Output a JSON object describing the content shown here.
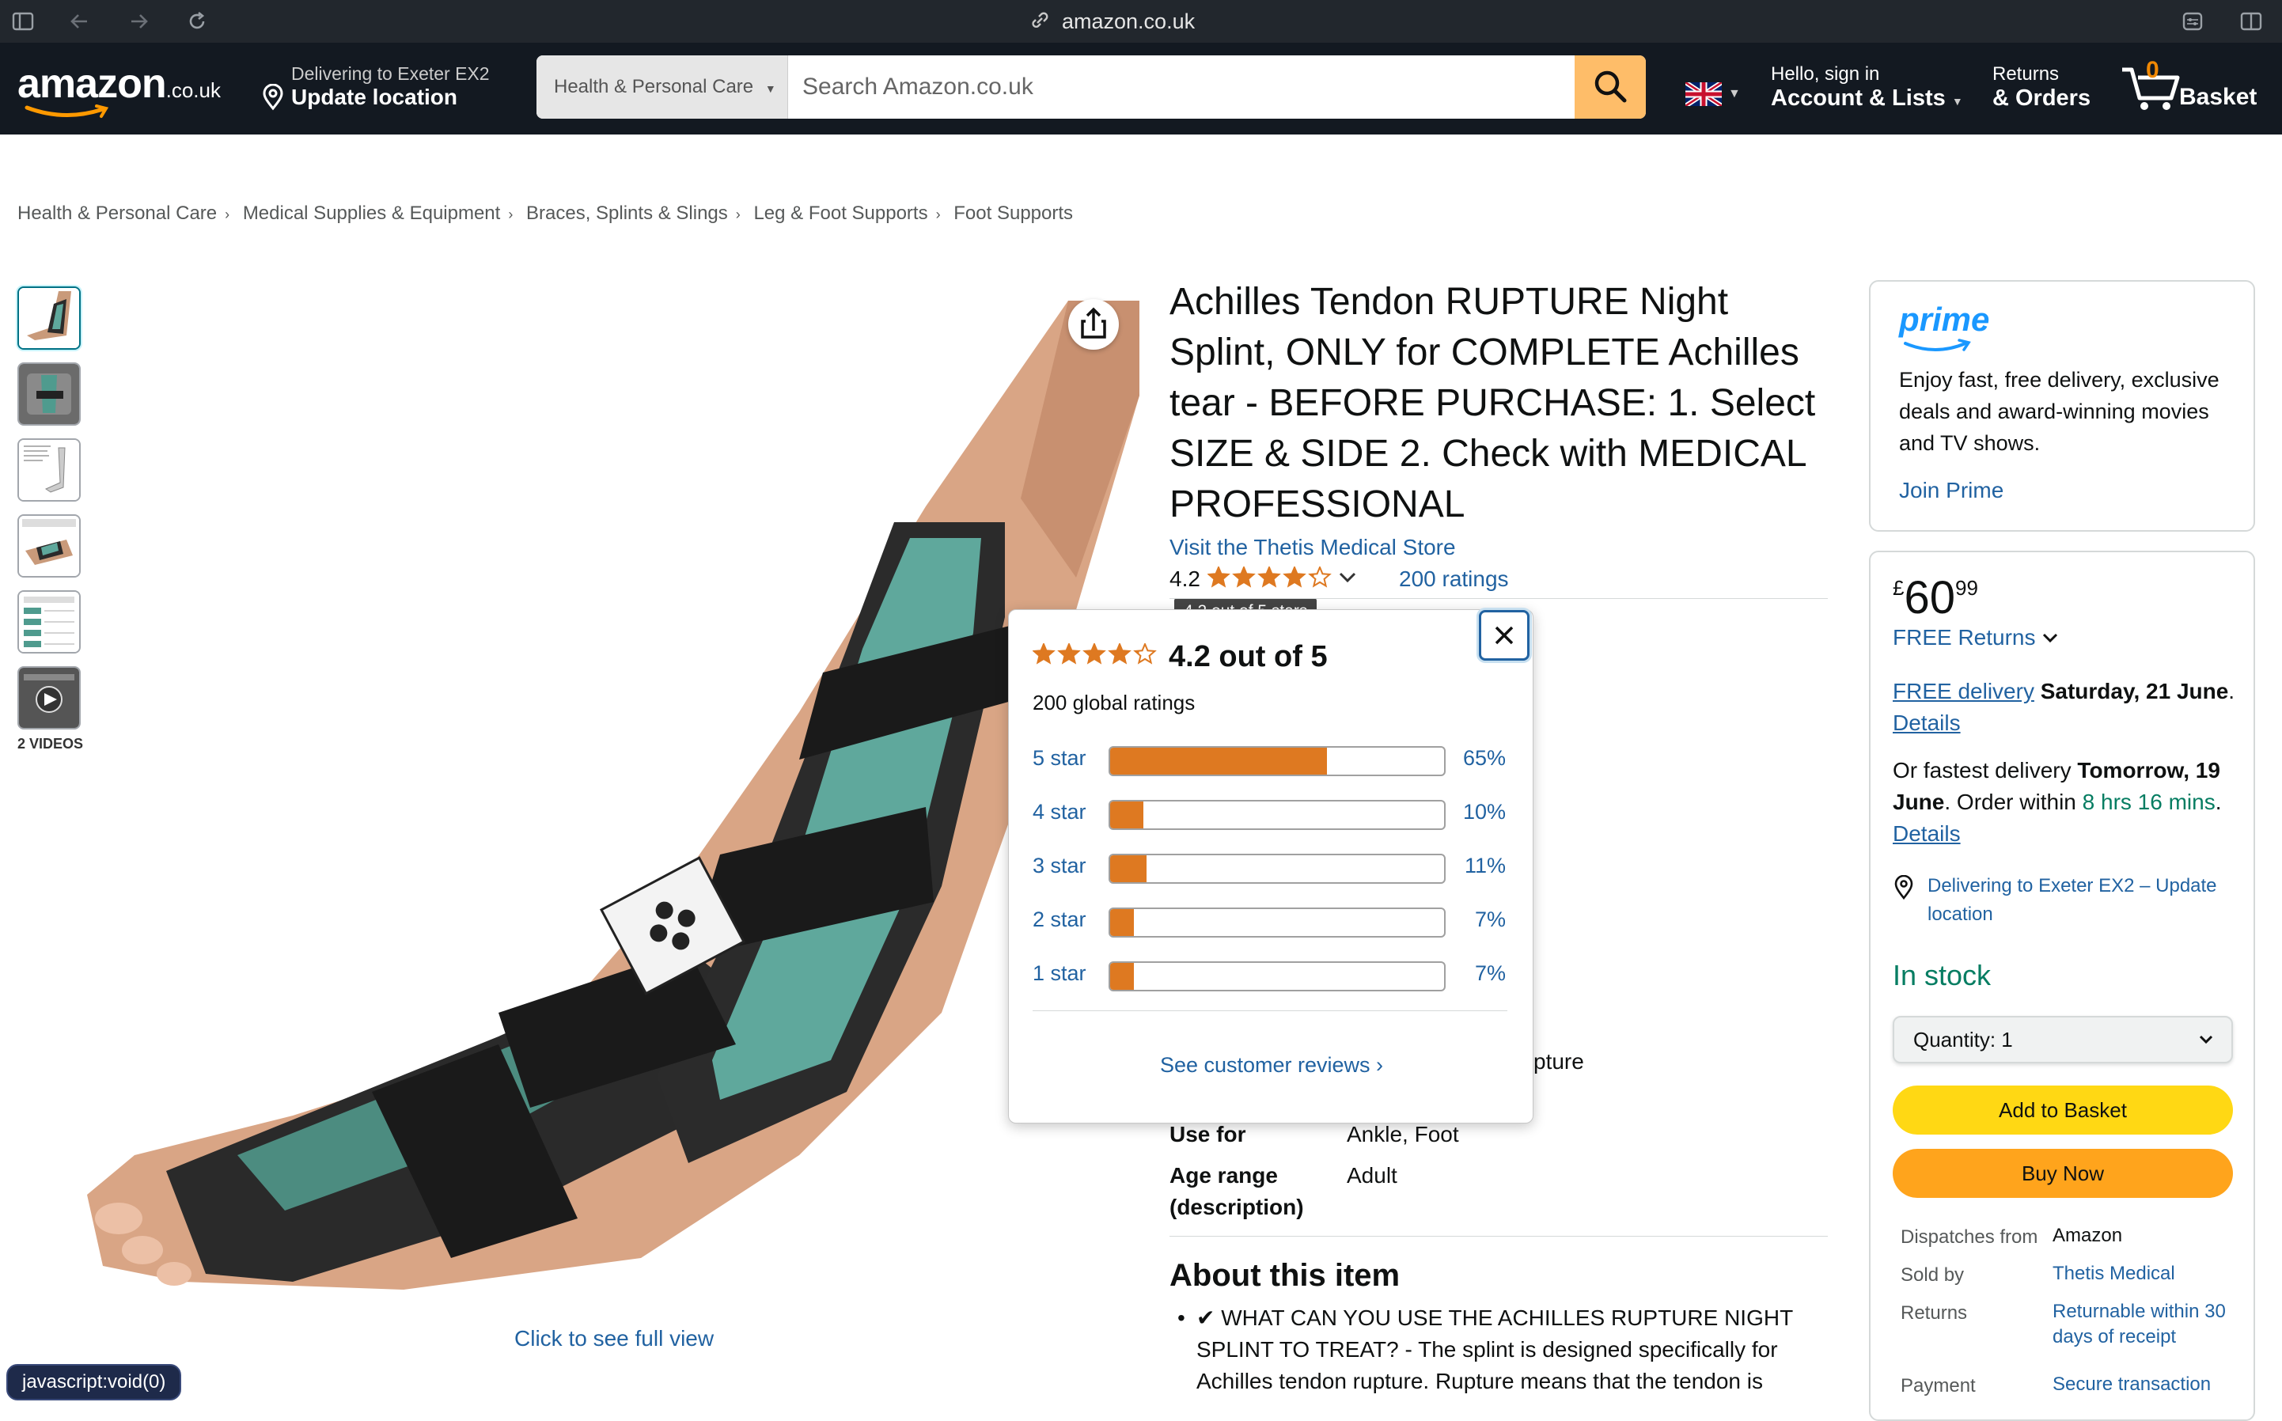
{
  "browser": {
    "url": "amazon.co.uk"
  },
  "header": {
    "logo_text": "amazon",
    "logo_tld": ".co.uk",
    "deliver_line1": "Delivering to Exeter EX2",
    "deliver_line2": "Update location",
    "search_category": "Health & Personal Care",
    "search_placeholder": "Search Amazon.co.uk",
    "account_line1": "Hello, sign in",
    "account_line2": "Account & Lists",
    "returns_line1": "Returns",
    "returns_line2": "& Orders",
    "basket_count": "0",
    "basket_label": "Basket"
  },
  "breadcrumb": [
    "Health & Personal Care",
    "Medical Supplies & Equipment",
    "Braces, Splints & Slings",
    "Leg & Foot Supports",
    "Foot Supports"
  ],
  "gallery": {
    "videos_label": "2 VIDEOS",
    "full_view": "Click to see full view"
  },
  "product": {
    "title": "Achilles Tendon RUPTURE Night Splint, ONLY for COMPLETE Achilles tear - BEFORE PURCHASE: 1. Select SIZE & SIDE 2. Check with MEDICAL PROFESSIONAL",
    "store_link": "Visit the Thetis Medical Store",
    "rating": "4.2",
    "rating_stars": 4.2,
    "ratings_count": "200 ratings",
    "tooltip": "4.2 out of 5 stars",
    "spec_partial": "pture",
    "specs": [
      {
        "key": "Use for",
        "value": "Ankle, Foot"
      },
      {
        "key": "Age range",
        "key2": "(description)",
        "value": "Adult"
      }
    ],
    "about_title": "About this item",
    "about_bullet": "✔ WHAT CAN YOU USE THE ACHILLES RUPTURE NIGHT SPLINT TO TREAT? - The splint is designed specifically for Achilles tendon rupture. Rupture means that the tendon is"
  },
  "popover": {
    "out_of": "4.2 out of 5",
    "global": "200 global ratings",
    "histogram": [
      {
        "label": "5 star",
        "pct": "65%",
        "value": 65
      },
      {
        "label": "4 star",
        "pct": "10%",
        "value": 10
      },
      {
        "label": "3 star",
        "pct": "11%",
        "value": 11
      },
      {
        "label": "2 star",
        "pct": "7%",
        "value": 7
      },
      {
        "label": "1 star",
        "pct": "7%",
        "value": 7
      }
    ],
    "see_reviews": "See customer reviews ›"
  },
  "prime": {
    "logo": "prime",
    "text": "Enjoy fast, free delivery, exclusive deals and award-winning movies and TV shows.",
    "join": "Join Prime"
  },
  "buybox": {
    "price_currency": "£",
    "price_whole": "60",
    "price_fraction": "99",
    "free_returns": "FREE Returns",
    "free_delivery_link": "FREE delivery",
    "free_delivery_date": "Saturday, 21 June",
    "details": "Details",
    "fastest_prefix": "Or fastest delivery",
    "fastest_date": "Tomorrow, 19 June",
    "order_within": "Order within",
    "order_time": "8 hrs 16 mins",
    "deliver_loc": "Delivering to Exeter EX2 – Update location",
    "in_stock": "In stock",
    "quantity_label": "Quantity:",
    "quantity_value": "1",
    "add_to_basket": "Add to Basket",
    "buy_now": "Buy Now",
    "dispatches_k": "Dispatches from",
    "dispatches_v": "Amazon",
    "sold_k": "Sold by",
    "sold_v": "Thetis Medical",
    "returns_k": "Returns",
    "returns_v": "Returnable within 30 days of receipt",
    "payment_k": "Payment",
    "payment_v": "Secure transaction"
  },
  "status_bar": "javascript:void(0)",
  "colors": {
    "accent": "#febd69",
    "star": "#de7921",
    "link": "#2162a1",
    "stock": "#067d62",
    "header": "#131921"
  }
}
